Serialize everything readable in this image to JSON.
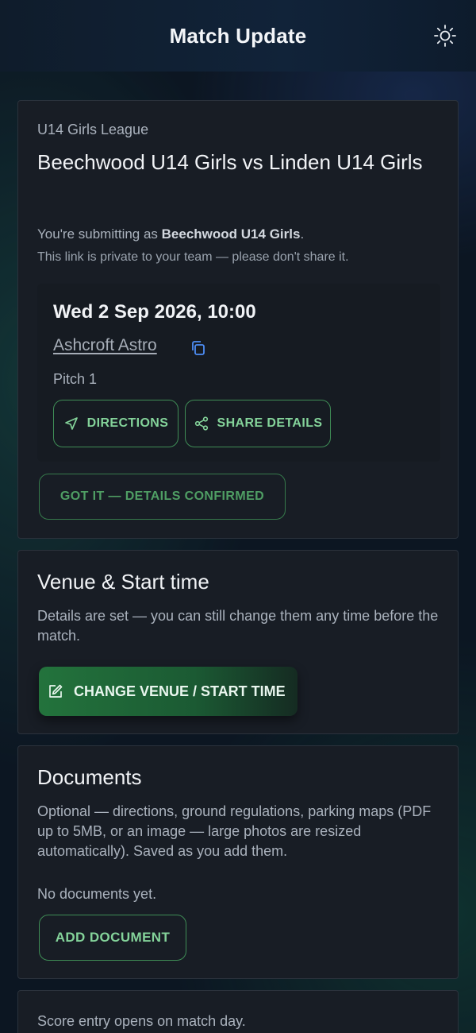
{
  "header": {
    "title": "Match Update",
    "theme_icon": "sun-icon"
  },
  "match": {
    "league": "U14 Girls League",
    "title": "Beechwood U14 Girls vs Linden U14 Girls",
    "submitting_prefix": "You're submitting as ",
    "team": "Beechwood U14 Girls",
    "submitting_suffix": ".",
    "private_note": "This link is private to your team — please don't share it.",
    "datetime": "Wed 2 Sep 2026, 10:00",
    "venue": "Ashcroft Astro",
    "pitch": "Pitch 1",
    "directions_label": "DIRECTIONS",
    "share_label": "SHARE DETAILS",
    "confirm_label": "GOT IT — DETAILS CONFIRMED"
  },
  "venue_section": {
    "title": "Venue & Start time",
    "description": "Details are set — you can still change them any time before the match.",
    "change_label": "CHANGE VENUE / START TIME"
  },
  "documents": {
    "title": "Documents",
    "description": "Optional — directions, ground regulations, parking maps (PDF up to 5MB, or an image — large photos are resized automatically). Saved as you add them.",
    "empty": "No documents yet.",
    "add_label": "ADD DOCUMENT"
  },
  "score": {
    "note": "Score entry opens on match day."
  },
  "colors": {
    "accent": "#84d39a",
    "link_blue": "#4d8ef7",
    "card": "#181d25"
  }
}
